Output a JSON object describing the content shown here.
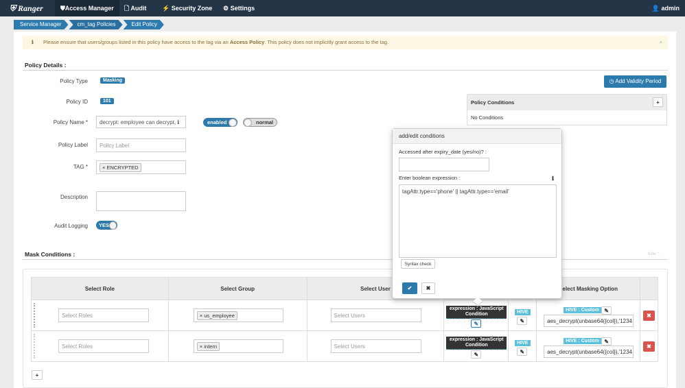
{
  "nav": {
    "brand": "Ranger",
    "items": [
      {
        "label": "Access Manager",
        "icon": "shield-icon"
      },
      {
        "label": "Audit",
        "icon": "file-icon"
      },
      {
        "label": "Security Zone",
        "icon": "zone-icon"
      },
      {
        "label": "Settings",
        "icon": "gear-icon"
      }
    ],
    "user": "admin"
  },
  "breadcrumb": [
    "Service Manager",
    "cm_tag Policies",
    "Edit Policy"
  ],
  "alert": {
    "pre": "Please ensure that users/groups listed in this policy have access to the tag via an ",
    "bold": "Access Policy",
    "post": ". This policy does not implicitly grant access to the tag."
  },
  "details": {
    "title": "Policy Details :",
    "policy_type_label": "Policy Type",
    "policy_type": "Masking",
    "policy_id_label": "Policy ID",
    "policy_id": "101",
    "policy_name_label": "Policy Name *",
    "policy_name": "decrypt: employee can decrypt,",
    "enabled": "enabled",
    "normal": "normal",
    "policy_label_label": "Policy Label",
    "policy_label_placeholder": "Policy Label",
    "tag_label": "TAG *",
    "tag": "ENCRYPTED",
    "description_label": "Description",
    "audit_label": "Audit Logging",
    "audit_value": "YES",
    "add_validity": "Add Validity Period",
    "conditions_title": "Policy Conditions",
    "no_conditions": "No Conditions"
  },
  "mask": {
    "title": "Mask Conditions :",
    "hide": "hide",
    "headers": [
      "Select Role",
      "Select Group",
      "Select User",
      "",
      "",
      "Select Masking Option",
      ""
    ],
    "rows": [
      {
        "role_ph": "Select Roles",
        "group": "us_employee",
        "user_ph": "Select Users",
        "expr": "expression : JavaScript Condition",
        "component": "HIVE",
        "mask_type": "HIVE : Custom",
        "mask_value": "aes_decrypt(unbase64({col}),'1234"
      },
      {
        "role_ph": "Select Roles",
        "group": "intern",
        "user_ph": "Select Users",
        "expr": "expression : JavaScript Condition",
        "component": "HIVE",
        "mask_type": "HIVE : Custom",
        "mask_value": "aes_decrypt(unbase64({col}),'1234"
      }
    ]
  },
  "popup": {
    "title": "add/edit conditions",
    "q1": "Accessed after expiry_date (yes/no)? :",
    "q1_value": "",
    "q2": "Enter boolean expression :",
    "expression": "tagAttr.type=='phone' || tagAttr.type=='email'",
    "syntax": "Syntax check"
  },
  "colors": {
    "nav": "#253548",
    "primary": "#2d7aad",
    "danger": "#d9534f",
    "info": "#5bc0de"
  }
}
